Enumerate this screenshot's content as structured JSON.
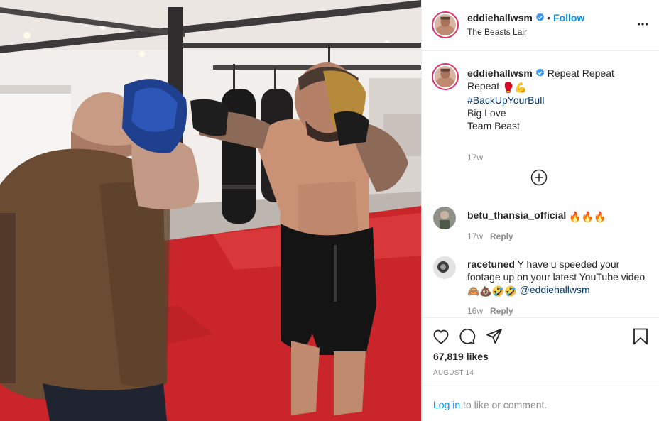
{
  "header": {
    "username": "eddiehallwsm",
    "separator": "•",
    "follow_label": "Follow",
    "location": "The Beasts Lair"
  },
  "caption": {
    "username": "eddiehallwsm",
    "text_line1": "Repeat Repeat",
    "text_line2_prefix": "Repeat",
    "emojis_line2": "🥊💪",
    "hashtag": "#BackUpYourBull",
    "line4": "Big Love",
    "line5": "Team Beast",
    "age": "17w"
  },
  "comments": [
    {
      "username": "betu_thansia_official",
      "text": "",
      "emojis": "🔥🔥🔥",
      "age": "17w",
      "reply_label": "Reply"
    },
    {
      "username": "racetuned",
      "text": "Y have u speeded your footage up on your latest YouTube video",
      "emojis": "🙈💩🤣🤣",
      "mention": "@eddiehallwsm",
      "age": "16w",
      "reply_label": "Reply"
    }
  ],
  "icons": {
    "verified": "verified-badge-icon",
    "more": "more-options-icon",
    "load_more": "plus-circle-icon",
    "like": "heart-icon",
    "comment": "comment-bubble-icon",
    "share": "paper-plane-icon",
    "save": "bookmark-icon"
  },
  "stats": {
    "likes": "67,819 likes",
    "date": "AUGUST 14"
  },
  "login": {
    "link_label": "Log in",
    "suffix": "to like or comment."
  },
  "colors": {
    "accent": "#0095f6",
    "verified": "#3897f0",
    "link_dark": "#00376b",
    "muted": "#8e8e8e",
    "border": "#efefef",
    "ring": "#e1306c"
  }
}
